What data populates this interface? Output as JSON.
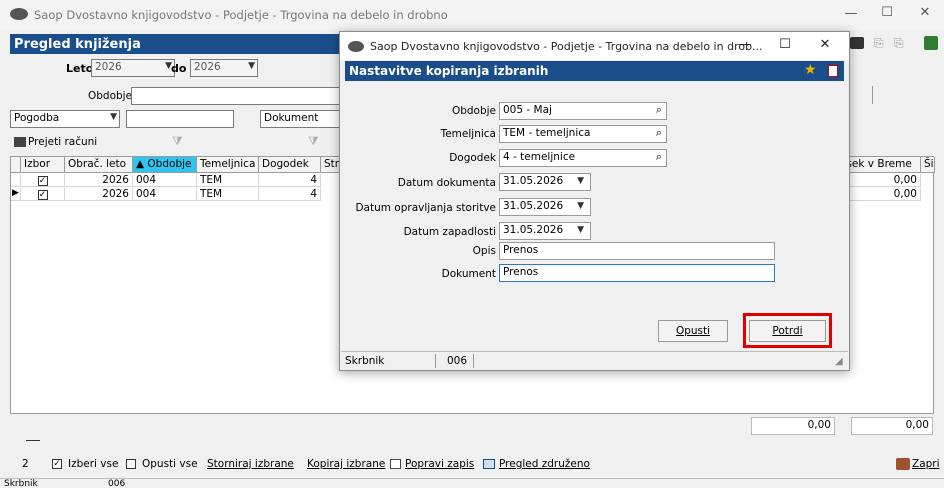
{
  "main_window": {
    "title": "Saop  Dvostavno knjigovodstvo - Podjetje - Trgovina na debelo in drobno",
    "header": "Pregled knjiženja",
    "leto_label": "Leto",
    "leto_from": "2026",
    "do_label": "do",
    "leto_to": "2026",
    "obdobje_label": "Obdobje",
    "filter_left": "Pogodba",
    "filter_right": "Dokument",
    "prejeti_racuni": "Prejeti računi",
    "columns": [
      "Izbor",
      "Obrač. leto",
      "Obdobje",
      "Temeljnica",
      "Dogodek",
      "Stran"
    ],
    "sorted_marker": "▲",
    "right_column": "esek v Breme",
    "right_column_2": "Ši",
    "rows": [
      {
        "leto": "2026",
        "obdobje": "004",
        "temeljnica": "TEM",
        "dogodek": "4",
        "znesek": "0,00"
      },
      {
        "leto": "2026",
        "obdobje": "004",
        "temeljnica": "TEM",
        "dogodek": "4",
        "znesek": "0,00"
      }
    ],
    "totals": [
      "0,00",
      "0,00"
    ],
    "count": "2",
    "toolbar": {
      "izberi_vse": "Izberi vse",
      "opusti_vse": "Opusti vse",
      "storniraj": "Storniraj izbrane",
      "kopiraj": "Kopiraj izbrane",
      "popravi": "Popravi zapis",
      "pregled": "Pregled združeno",
      "zapri": "Zapri"
    },
    "status_label": "Skrbnik",
    "status_value": "006"
  },
  "dialog": {
    "title": "Saop  Dvostavno knjigovodstvo - Podjetje - Trgovina na debelo in drob...",
    "header": "Nastavitve kopiranja izbranih",
    "obdobje_label": "Obdobje",
    "obdobje_value": "005 - Maj",
    "temeljnica_label": "Temeljnica",
    "temeljnica_value": "TEM - temeljnica",
    "dogodek_label": "Dogodek",
    "dogodek_value": "4 - temeljnice",
    "datum_dokumenta_label": "Datum dokumenta",
    "datum_dokumenta_value": "31.05.2026",
    "datum_storitve_label": "Datum opravljanja storitve",
    "datum_storitve_value": "31.05.2026",
    "datum_zapadlosti_label": "Datum zapadlosti",
    "datum_zapadlosti_value": "31.05.2026",
    "opis_label": "Opis",
    "opis_value": "Prenos",
    "dokument_label": "Dokument",
    "dokument_value": "Prenos",
    "opusti": "Opusti",
    "potrdi": "Potrdi",
    "status_label": "Skrbnik",
    "status_value": "006",
    "highlight_color": "#e00000"
  }
}
